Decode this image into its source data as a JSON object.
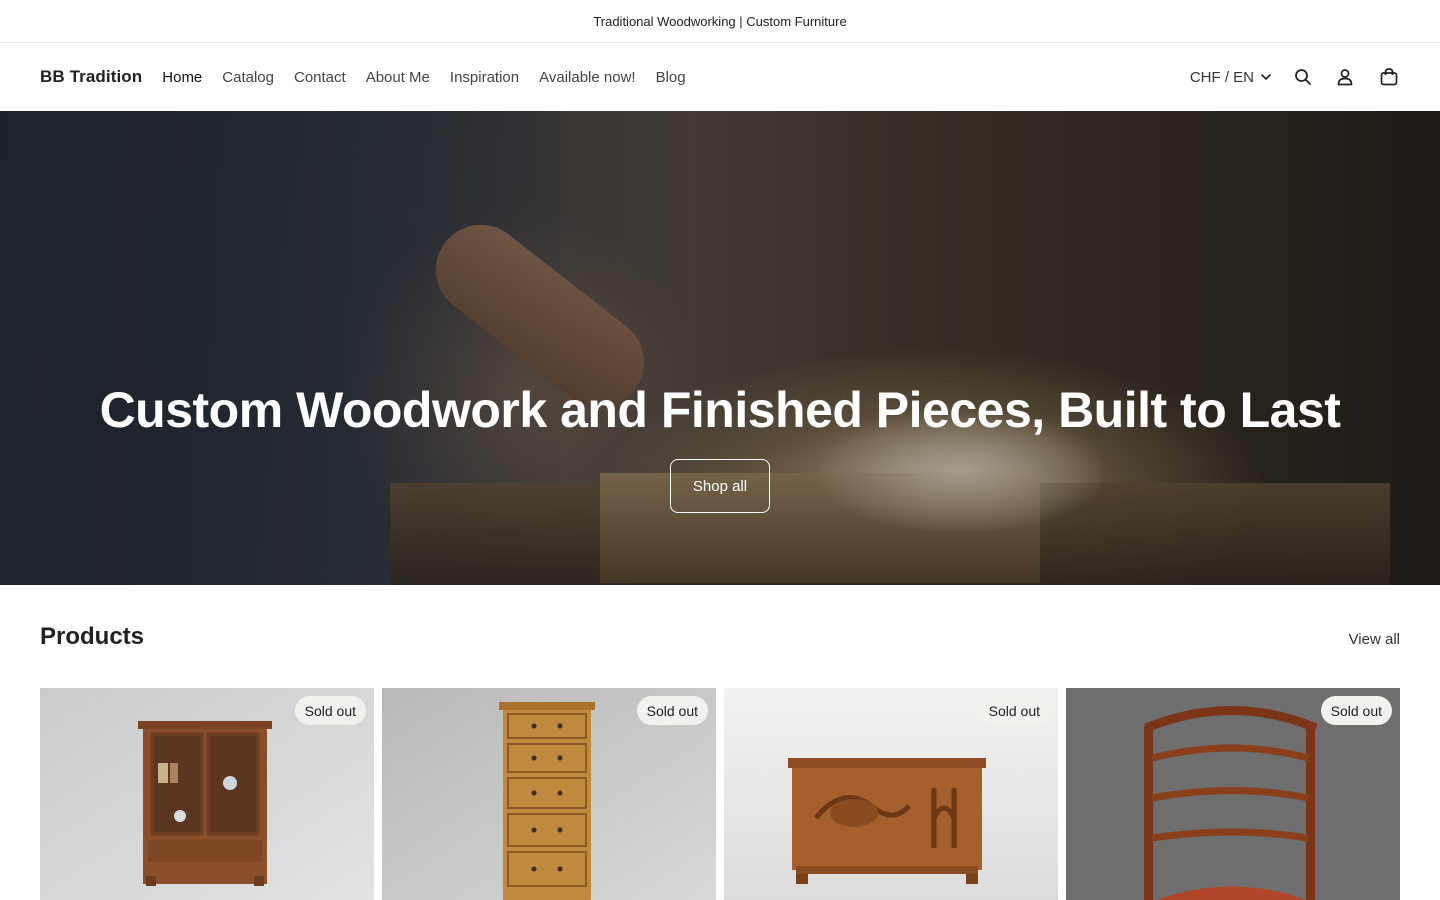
{
  "announcement": "Traditional Woodworking | Custom Furniture",
  "header": {
    "brand": "BB Tradition",
    "nav": [
      "Home",
      "Catalog",
      "Contact",
      "About Me",
      "Inspiration",
      "Available now!",
      "Blog"
    ],
    "locale": "CHF / EN",
    "icons": [
      "search-icon",
      "account-icon",
      "cart-icon"
    ]
  },
  "hero": {
    "title": "Custom Woodwork and Finished Pieces, Built to Last",
    "button": "Shop all"
  },
  "products": {
    "title": "Products",
    "view_all": "View all",
    "items": [
      {
        "badge": "Sold out",
        "image": "wooden display cabinet"
      },
      {
        "badge": "Sold out",
        "image": "tall chest of drawers"
      },
      {
        "badge": "Sold out",
        "image": "carved wooden chest"
      },
      {
        "badge": "Sold out",
        "image": "carved wooden chair"
      }
    ]
  },
  "colors": {
    "text": "#222222",
    "hero_text": "#ffffff",
    "badge_bg": "#f1f1ee",
    "wood": "#8a4f2a"
  }
}
